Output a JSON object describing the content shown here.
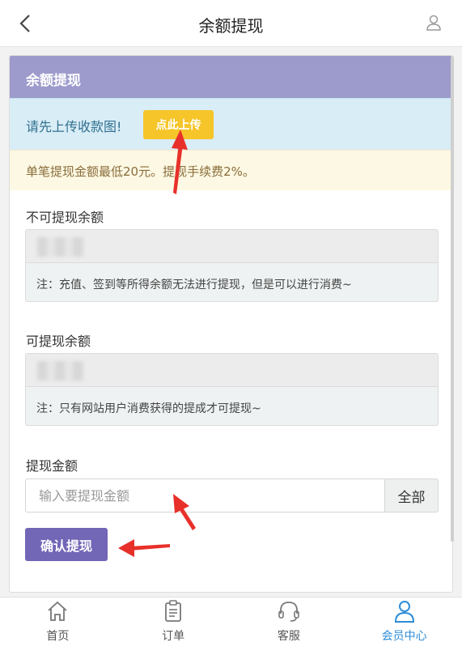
{
  "header": {
    "title": "余额提现"
  },
  "card": {
    "title": "余额提现",
    "upload_notice": "请先上传收款图!",
    "upload_button": "点此上传",
    "rule_notice": "单笔提现金额最低20元。提现手续费2%。"
  },
  "non_withdrawable": {
    "label": "不可提现余额",
    "note": "注：充值、签到等所得余额无法进行提现，但是可以进行消费~"
  },
  "withdrawable": {
    "label": "可提现余额",
    "note": "注：只有网站用户消费获得的提成才可提现~"
  },
  "amount": {
    "label": "提现金额",
    "placeholder": "输入要提现金额",
    "all_button": "全部"
  },
  "confirm_button": "确认提现",
  "tabs": [
    {
      "label": "首页",
      "icon": "home-icon"
    },
    {
      "label": "订单",
      "icon": "clipboard-icon"
    },
    {
      "label": "客服",
      "icon": "headset-icon"
    },
    {
      "label": "会员中心",
      "icon": "user-icon",
      "active": true
    }
  ],
  "colors": {
    "header_bar": "#9d9bcc",
    "info_bg": "#d9edf7",
    "warn_bg": "#fcf8e3",
    "upload_button": "#f5c52a",
    "confirm_button": "#7266b6",
    "active_tab": "#2d8cd8",
    "annotation_arrow": "#e8302a"
  }
}
